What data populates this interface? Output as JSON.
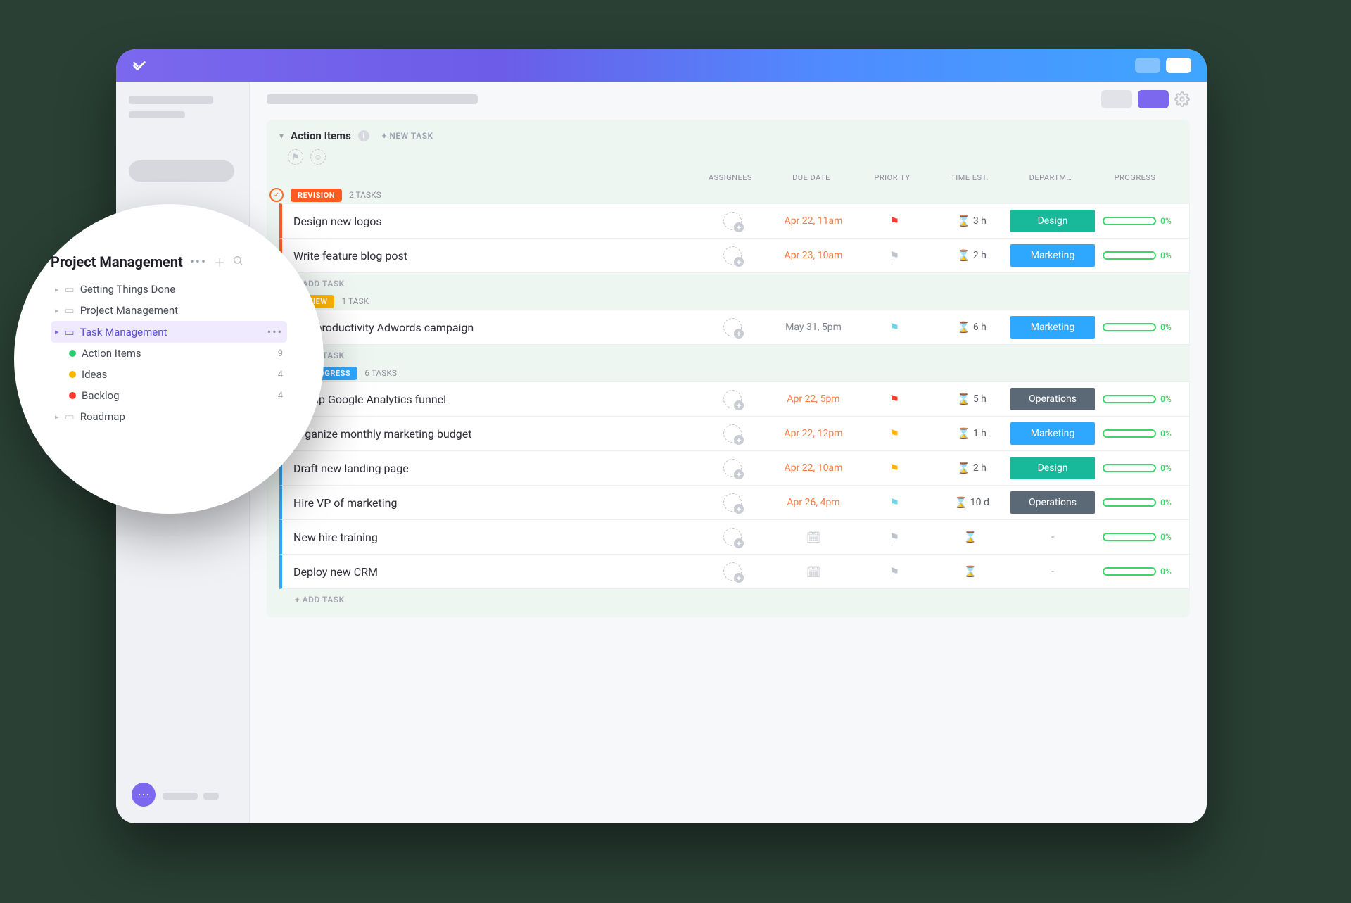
{
  "panel": {
    "title": "Action Items",
    "new_task": "+ NEW TASK"
  },
  "columns": {
    "assignees": "ASSIGNEES",
    "due": "DUE DATE",
    "priority": "PRIORITY",
    "est": "TIME EST.",
    "dept": "DEPARTM…",
    "progress": "PROGRESS"
  },
  "add_task": "+ ADD TASK",
  "groups": [
    {
      "status": "REVISION",
      "color": "orange",
      "count": "2 TASKS",
      "tasks": [
        {
          "title": "Design new logos",
          "due": "Apr 22, 11am",
          "due_tone": "orange",
          "flag": "red",
          "est": "3 h",
          "dept": "Design",
          "dept_class": "design",
          "progress": "0%"
        },
        {
          "title": "Write feature blog post",
          "due": "Apr 23, 10am",
          "due_tone": "orange",
          "flag": "gray",
          "est": "2 h",
          "dept": "Marketing",
          "dept_class": "marketing",
          "progress": "0%"
        }
      ]
    },
    {
      "status": "REVIEW",
      "color": "yellow",
      "count": "1 TASK",
      "tasks": [
        {
          "title": "Run productivity Adwords campaign",
          "due": "May 31, 5pm",
          "due_tone": "gray",
          "flag": "cyan",
          "est": "6 h",
          "dept": "Marketing",
          "dept_class": "marketing",
          "progress": "0%"
        }
      ]
    },
    {
      "status": "IN PROGRESS",
      "color": "blue",
      "count": "6 TASKS",
      "tasks": [
        {
          "title": "Set up Google Analytics funnel",
          "due": "Apr 22, 5pm",
          "due_tone": "orange",
          "flag": "red",
          "est": "5 h",
          "dept": "Operations",
          "dept_class": "ops",
          "progress": "0%"
        },
        {
          "title": "Organize monthly marketing budget",
          "due": "Apr 22, 12pm",
          "due_tone": "orange",
          "flag": "amber",
          "est": "1 h",
          "dept": "Marketing",
          "dept_class": "marketing",
          "progress": "0%"
        },
        {
          "title": "Draft new landing page",
          "due": "Apr 22, 10am",
          "due_tone": "orange",
          "flag": "amber",
          "est": "2 h",
          "dept": "Design",
          "dept_class": "design",
          "progress": "0%"
        },
        {
          "title": "Hire VP of marketing",
          "due": "Apr 26, 4pm",
          "due_tone": "orange",
          "flag": "cyan",
          "est": "10 d",
          "dept": "Operations",
          "dept_class": "ops",
          "progress": "0%"
        },
        {
          "title": "New hire training",
          "due": "",
          "due_tone": "gray",
          "flag": "gray",
          "est": "",
          "dept": "-",
          "dept_class": "none",
          "progress": "0%"
        },
        {
          "title": "Deploy new CRM",
          "due": "",
          "due_tone": "gray",
          "flag": "gray",
          "est": "",
          "dept": "-",
          "dept_class": "none",
          "progress": "0%"
        }
      ]
    }
  ],
  "sidebar": {
    "title": "Project Management",
    "items": [
      {
        "label": "Getting Things Done",
        "kind": "folder"
      },
      {
        "label": "Project Management",
        "kind": "folder"
      },
      {
        "label": "Task Management",
        "kind": "folder",
        "active": true
      },
      {
        "label": "Action Items",
        "kind": "list",
        "dot": "green",
        "count": "9"
      },
      {
        "label": "Ideas",
        "kind": "list",
        "dot": "yellow",
        "count": "4"
      },
      {
        "label": "Backlog",
        "kind": "list",
        "dot": "red",
        "count": "4"
      },
      {
        "label": "Roadmap",
        "kind": "folder"
      }
    ]
  }
}
